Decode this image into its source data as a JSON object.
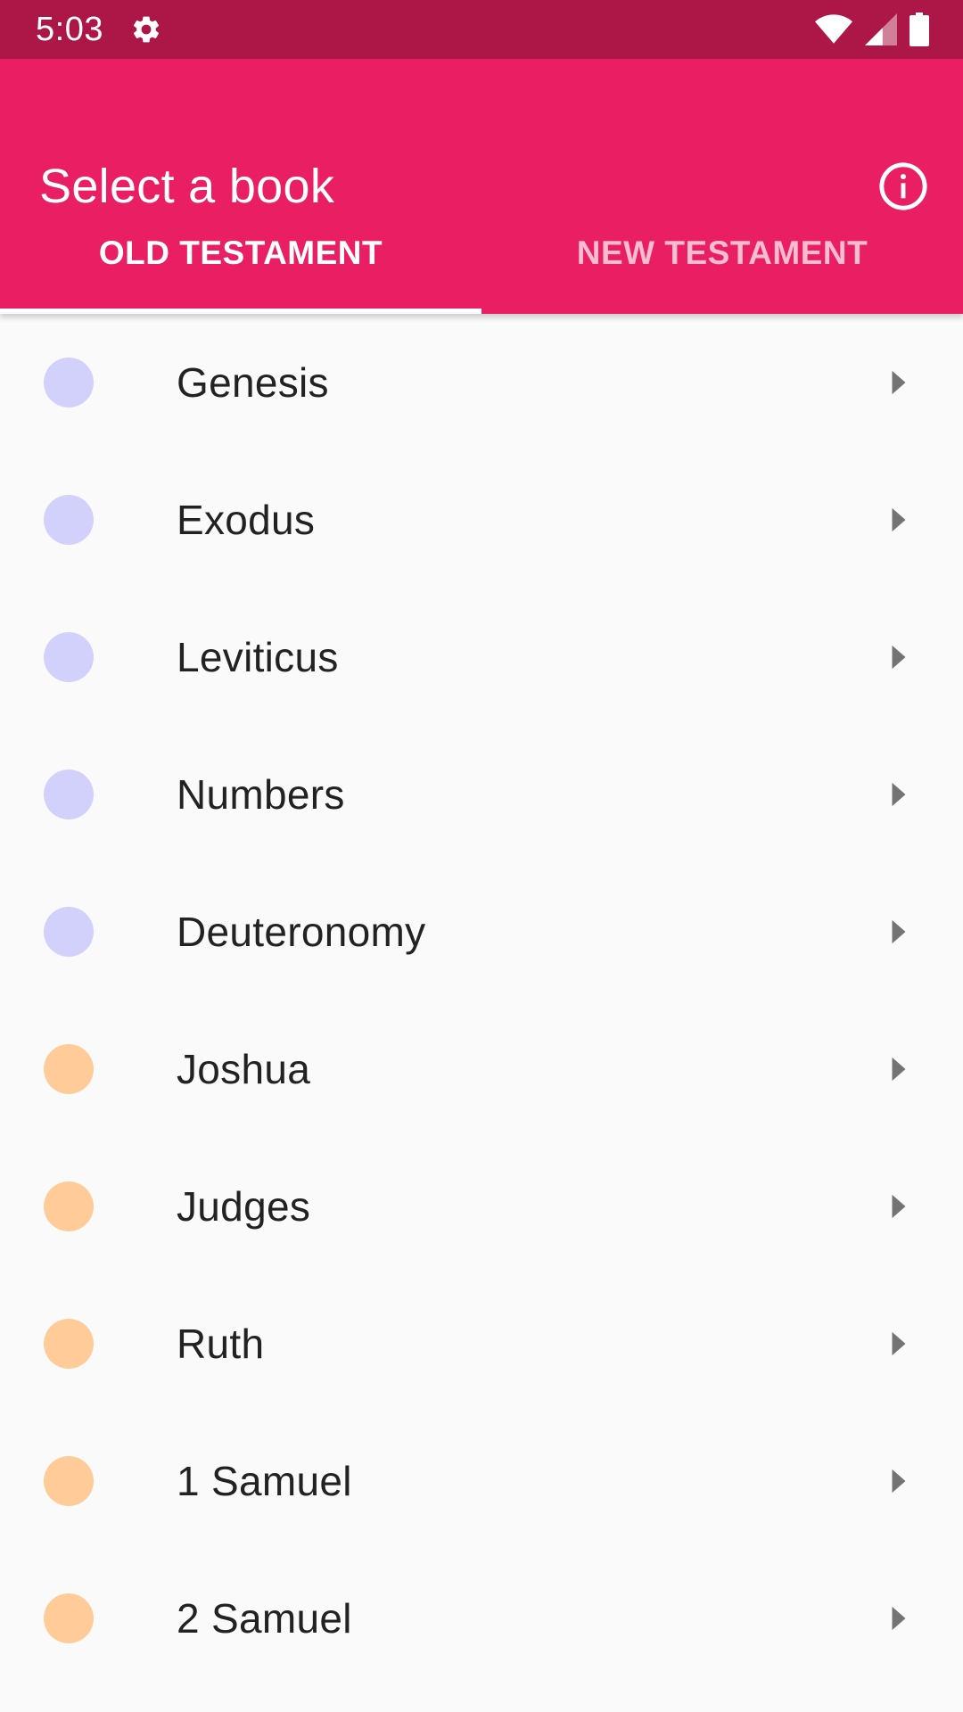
{
  "status": {
    "time": "5:03"
  },
  "app_bar": {
    "title": "Select a book"
  },
  "tabs": [
    {
      "label": "OLD TESTAMENT",
      "active": true
    },
    {
      "label": "NEW TESTAMENT",
      "active": false
    }
  ],
  "colors": {
    "status_bar": "#ad1748",
    "app_bar": "#e91e63",
    "pentateuch_dot": "#d1d1fc",
    "history_dot": "#ffcc99",
    "background": "#fafafa"
  },
  "books": [
    {
      "name": "Genesis",
      "dot_color": "#d1d1fc"
    },
    {
      "name": "Exodus",
      "dot_color": "#d1d1fc"
    },
    {
      "name": "Leviticus",
      "dot_color": "#d1d1fc"
    },
    {
      "name": "Numbers",
      "dot_color": "#d1d1fc"
    },
    {
      "name": "Deuteronomy",
      "dot_color": "#d1d1fc"
    },
    {
      "name": "Joshua",
      "dot_color": "#ffcc99"
    },
    {
      "name": "Judges",
      "dot_color": "#ffcc99"
    },
    {
      "name": "Ruth",
      "dot_color": "#ffcc99"
    },
    {
      "name": "1 Samuel",
      "dot_color": "#ffcc99"
    },
    {
      "name": "2 Samuel",
      "dot_color": "#ffcc99"
    }
  ],
  "icons": {
    "status_gear": "gear-icon",
    "wifi": "wifi-icon",
    "signal": "signal-icon",
    "battery": "battery-icon",
    "info": "info-icon",
    "row_chevron": "chevron-right-icon"
  }
}
